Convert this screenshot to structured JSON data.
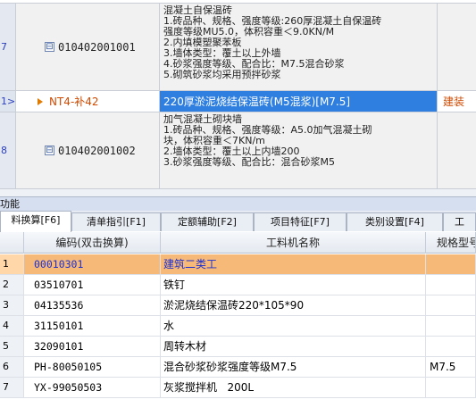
{
  "top_grid": {
    "row_a": {
      "num": "7",
      "code": "010402001001",
      "toggle": "⊟",
      "desc": [
        "混凝土自保温砖",
        "1.砖品种、规格、强度等级:260厚混凝土自保温砖",
        "强度等级MU5.0，体积容重＜9.0KN/M",
        "2.内填模塑聚苯板",
        "3.墙体类型：覆土以上外墙",
        "4.砂浆强度等级、配合比：M7.5混合砂浆",
        "5.砌筑砂浆均采用预拌砂浆"
      ]
    },
    "row_sel": {
      "num": "1>",
      "code": "NT4-补42",
      "desc": "220厚淤泥烧结保温砖(M5混浆)[M7.5]",
      "unit": "建装"
    },
    "row_b": {
      "num": "8",
      "code": "010402001002",
      "toggle": "⊟",
      "desc": [
        "加气混凝土砌块墙",
        "1.砖品种、规格、强度等级：A5.0加气混凝土砌",
        "块，体积容重＜7KN/m",
        "2.墙体类型：覆土以上内墙200",
        "3.砂浆强度等级、配合比：混合砂浆M5"
      ]
    }
  },
  "panel": {
    "title": "功能"
  },
  "tabs": [
    {
      "label": "料换算[F6]",
      "active": true
    },
    {
      "label": "清单指引[F1]",
      "active": false
    },
    {
      "label": "定额辅助[F2]",
      "active": false
    },
    {
      "label": "项目特征[F7]",
      "active": false
    },
    {
      "label": "类别设置[F4]",
      "active": false
    },
    {
      "label": "工",
      "active": false
    }
  ],
  "bottom_grid": {
    "headers": {
      "code": "编码(双击换算)",
      "name": "工料机名称",
      "spec": "规格型号"
    },
    "rows": [
      {
        "num": "1",
        "code": "00010301",
        "name": "建筑二类工",
        "spec": ""
      },
      {
        "num": "2",
        "code": "03510701",
        "name": "铁钉",
        "spec": ""
      },
      {
        "num": "3",
        "code": "04135536",
        "name": "淤泥烧结保温砖220*105*90",
        "spec": ""
      },
      {
        "num": "4",
        "code": "31150101",
        "name": "水",
        "spec": ""
      },
      {
        "num": "5",
        "code": "32090101",
        "name": "周转木材",
        "spec": ""
      },
      {
        "num": "6",
        "code": "PH-80050105",
        "name": "混合砂浆砂浆强度等级M7.5",
        "spec": "M7.5"
      },
      {
        "num": "7",
        "code": "YX-99050503",
        "name": "灰浆搅拌机   200L",
        "spec": ""
      }
    ]
  },
  "colors": {
    "selected_row": "#2f7fe0",
    "highlight_row": "#f7b977",
    "accent_text": "#d04a00"
  }
}
